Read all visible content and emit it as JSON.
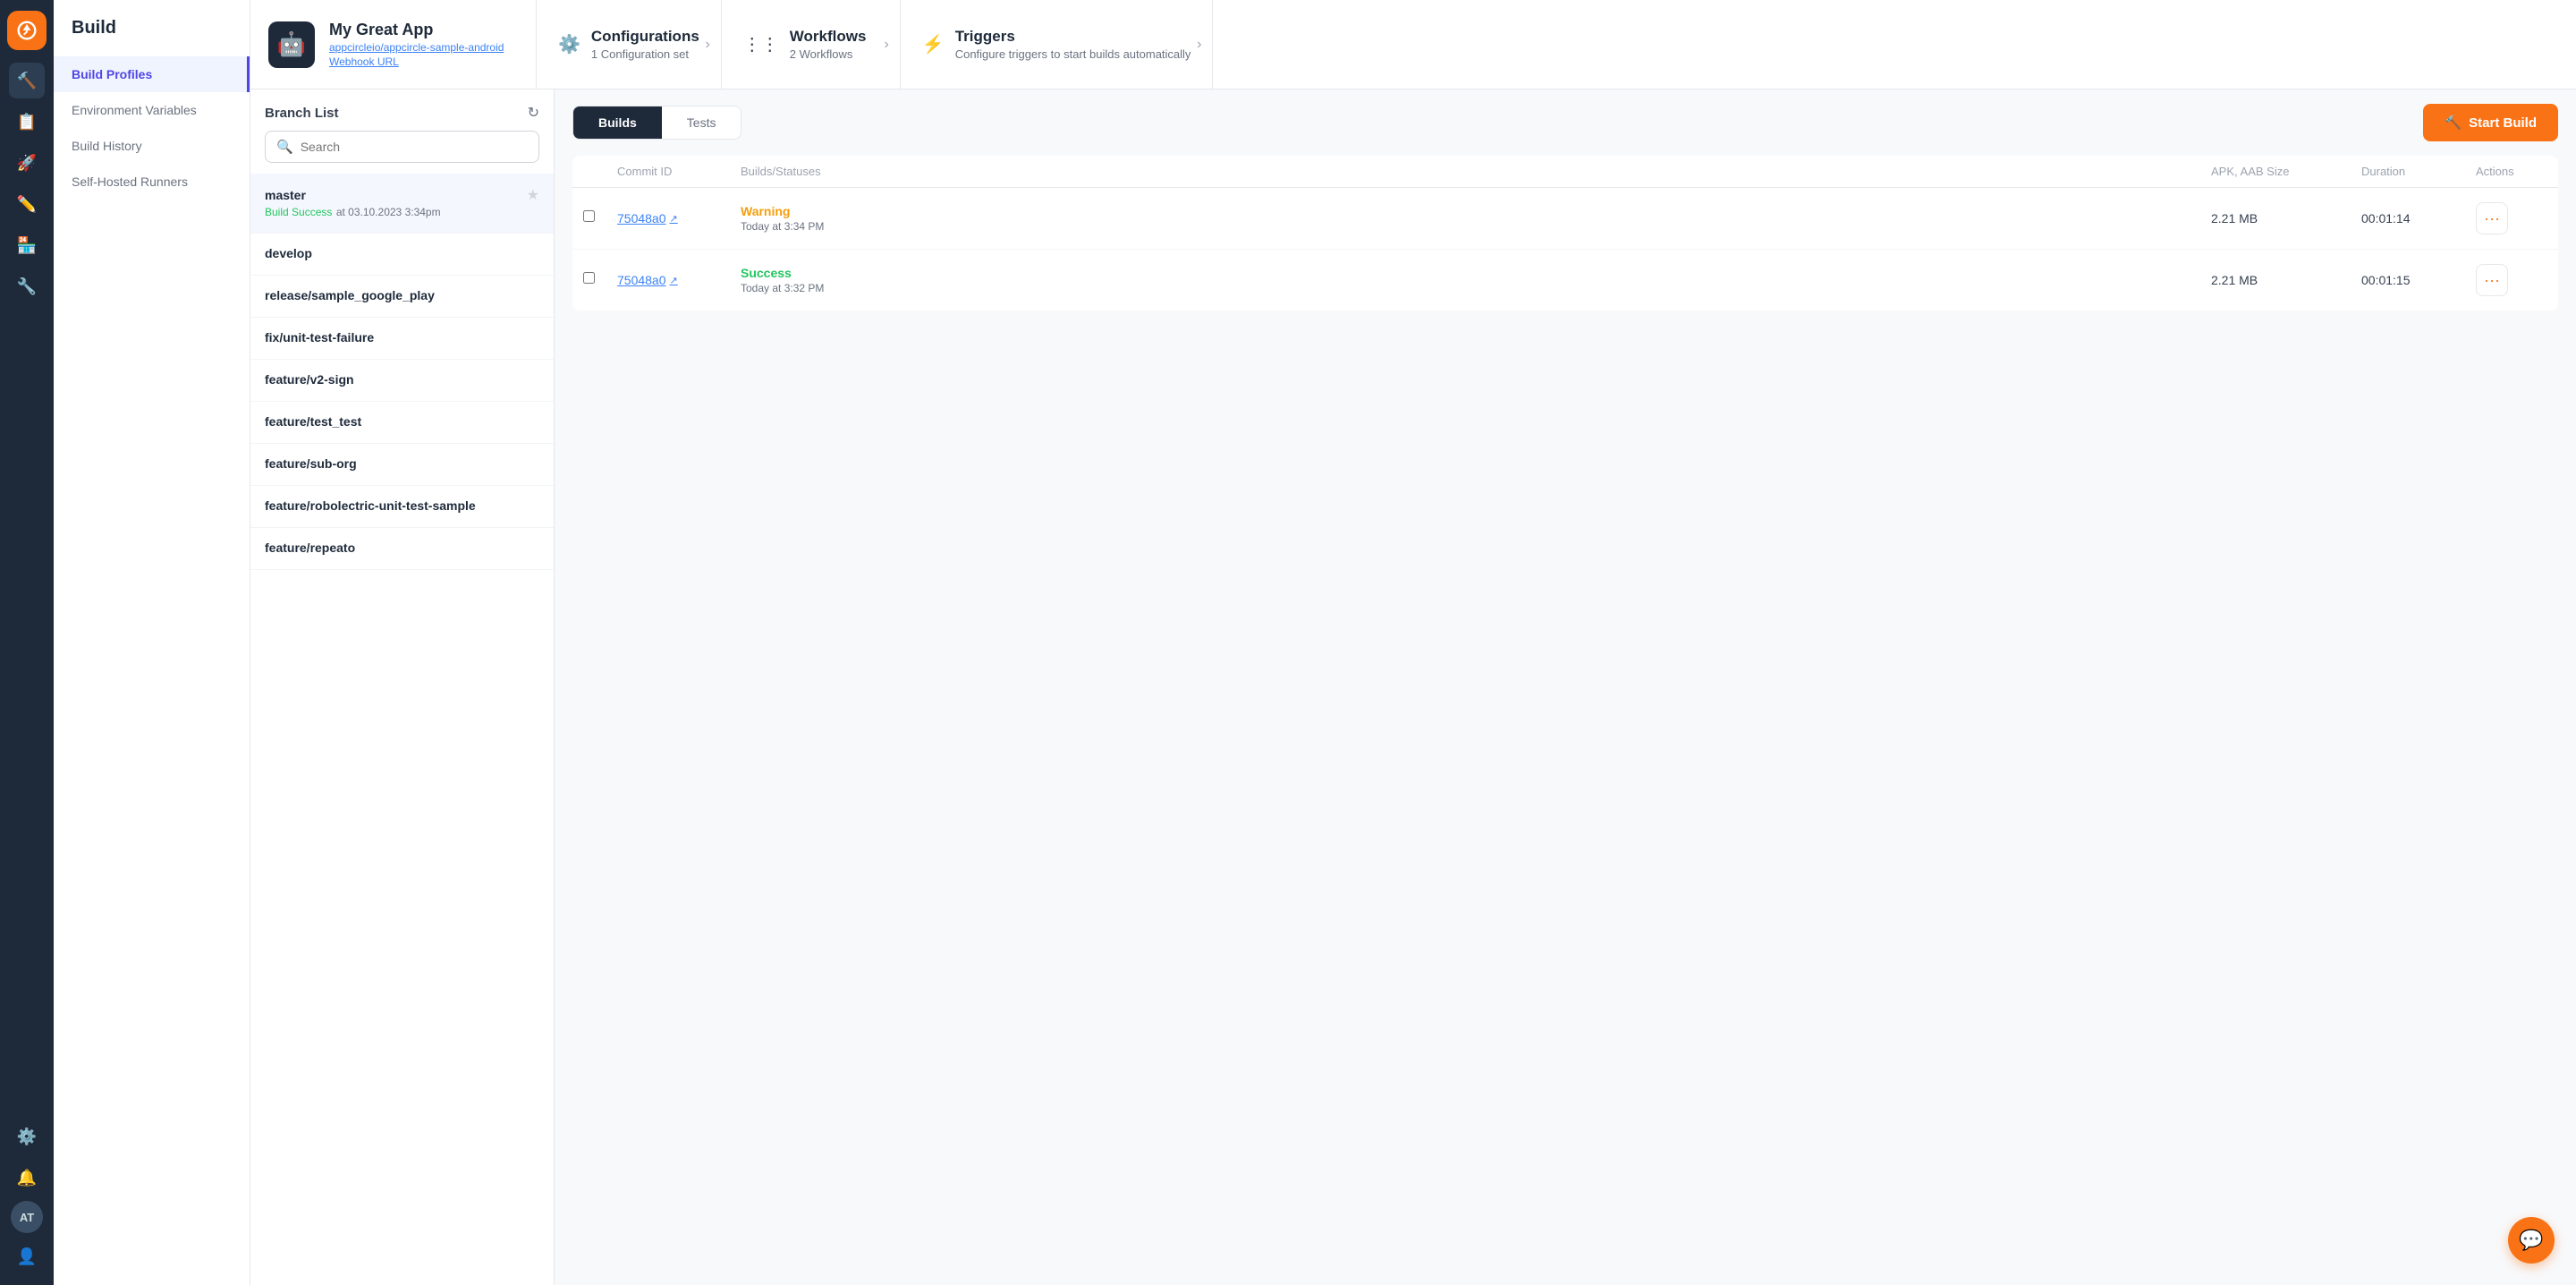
{
  "app": {
    "title": "Build",
    "icon_label": "AC"
  },
  "sidebar": {
    "items": [
      {
        "label": "Build Profiles",
        "active": true
      },
      {
        "label": "Environment Variables",
        "active": false
      },
      {
        "label": "Build History",
        "active": false
      },
      {
        "label": "Self-Hosted Runners",
        "active": false
      }
    ]
  },
  "top_nav": {
    "app_name": "My Great App",
    "app_repo": "appcircleio/appcircle-sample-android",
    "app_webhook": "Webhook URL",
    "items": [
      {
        "icon": "⚙",
        "label": "Configurations",
        "sub": "1 Configuration set"
      },
      {
        "icon": "⋮⋮",
        "label": "Workflows",
        "sub": "2 Workflows"
      },
      {
        "icon": "⚡",
        "label": "Triggers",
        "sub": "Configure triggers to start builds automatically"
      }
    ]
  },
  "branch": {
    "title": "Branch List",
    "search_placeholder": "Search",
    "items": [
      {
        "name": "master",
        "status": "Build Success",
        "status_type": "success",
        "time": "at 03.10.2023 3:34pm",
        "active": true
      },
      {
        "name": "develop",
        "active": false
      },
      {
        "name": "release/sample_google_play",
        "active": false
      },
      {
        "name": "fix/unit-test-failure",
        "active": false
      },
      {
        "name": "feature/v2-sign",
        "active": false
      },
      {
        "name": "feature/test_test",
        "active": false
      },
      {
        "name": "feature/sub-org",
        "active": false
      },
      {
        "name": "feature/robolectric-unit-test-sample",
        "active": false
      },
      {
        "name": "feature/repeato",
        "active": false
      }
    ]
  },
  "builds": {
    "tabs": [
      {
        "label": "Builds",
        "active": true
      },
      {
        "label": "Tests",
        "active": false
      }
    ],
    "start_build_label": "Start Build",
    "table": {
      "headers": [
        "",
        "Commit ID",
        "Builds/Statuses",
        "APK, AAB Size",
        "Duration",
        "Actions"
      ],
      "rows": [
        {
          "commit_id": "75048a0",
          "status": "Warning",
          "status_type": "warning",
          "status_time": "Today at 3:34 PM",
          "size": "2.21 MB",
          "duration": "00:01:14"
        },
        {
          "commit_id": "75048a0",
          "status": "Success",
          "status_type": "success",
          "status_time": "Today at 3:32 PM",
          "size": "2.21 MB",
          "duration": "00:01:15"
        }
      ]
    }
  },
  "chat_btn_label": "💬"
}
